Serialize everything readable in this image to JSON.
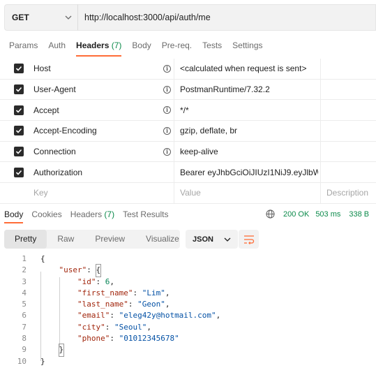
{
  "request": {
    "method": "GET",
    "url": "http://localhost:3000/api/auth/me"
  },
  "request_tabs": [
    {
      "label": "Params",
      "active": false
    },
    {
      "label": "Auth",
      "active": false
    },
    {
      "label": "Headers",
      "count": "(7)",
      "active": true
    },
    {
      "label": "Body",
      "active": false
    },
    {
      "label": "Pre-req.",
      "active": false
    },
    {
      "label": "Tests",
      "active": false
    },
    {
      "label": "Settings",
      "active": false
    }
  ],
  "headers": [
    {
      "key": "Host",
      "value": "<calculated when request is sent>",
      "checked": true,
      "info": true
    },
    {
      "key": "User-Agent",
      "value": "PostmanRuntime/7.32.2",
      "checked": true,
      "info": true
    },
    {
      "key": "Accept",
      "value": "*/*",
      "checked": true,
      "info": true
    },
    {
      "key": "Accept-Encoding",
      "value": "gzip, deflate, br",
      "checked": true,
      "info": true
    },
    {
      "key": "Connection",
      "value": "keep-alive",
      "checked": true,
      "info": true
    },
    {
      "key": "Authorization",
      "value": "Bearer eyJhbGciOiJIUzI1NiJ9.eyJlbW…",
      "checked": true,
      "info": false
    }
  ],
  "headers_placeholder": {
    "key": "Key",
    "value": "Value",
    "description": "Description"
  },
  "response_tabs": [
    {
      "label": "Body",
      "active": true
    },
    {
      "label": "Cookies",
      "active": false
    },
    {
      "label": "Headers",
      "count": "(7)",
      "active": false
    },
    {
      "label": "Test Results",
      "active": false
    }
  ],
  "status": {
    "code": "200 OK",
    "time": "503 ms",
    "size": "338 B"
  },
  "view_modes": [
    {
      "label": "Pretty",
      "active": true
    },
    {
      "label": "Raw",
      "active": false
    },
    {
      "label": "Preview",
      "active": false
    },
    {
      "label": "Visualize",
      "active": false
    }
  ],
  "format": "JSON",
  "icons": {
    "method_chevron": "chevron-down-icon",
    "info": "info-icon",
    "checkbox": "checkbox-checked-icon",
    "globe": "globe-icon",
    "format_chevron": "chevron-down-icon",
    "wrap": "wrap-lines-icon"
  },
  "colors": {
    "accent": "#ff6c37",
    "status_ok": "#0b8a4a",
    "json_key": "#a1260d",
    "json_string": "#0451a5",
    "json_number": "#098658"
  },
  "code_lines": [
    {
      "n": "1",
      "text": "{"
    },
    {
      "n": "2",
      "text": "\"user\": {"
    },
    {
      "n": "3",
      "text": "\"id\": 6,"
    },
    {
      "n": "4",
      "text": "\"first_name\": \"Lim\","
    },
    {
      "n": "5",
      "text": "\"last_name\": \"Geon\","
    },
    {
      "n": "6",
      "text": "\"email\": \"eleg42y@hotmail.com\","
    },
    {
      "n": "7",
      "text": "\"city\": \"Seoul\","
    },
    {
      "n": "8",
      "text": "\"phone\": \"01012345678\""
    },
    {
      "n": "9",
      "text": "}"
    },
    {
      "n": "10",
      "text": "}"
    }
  ]
}
